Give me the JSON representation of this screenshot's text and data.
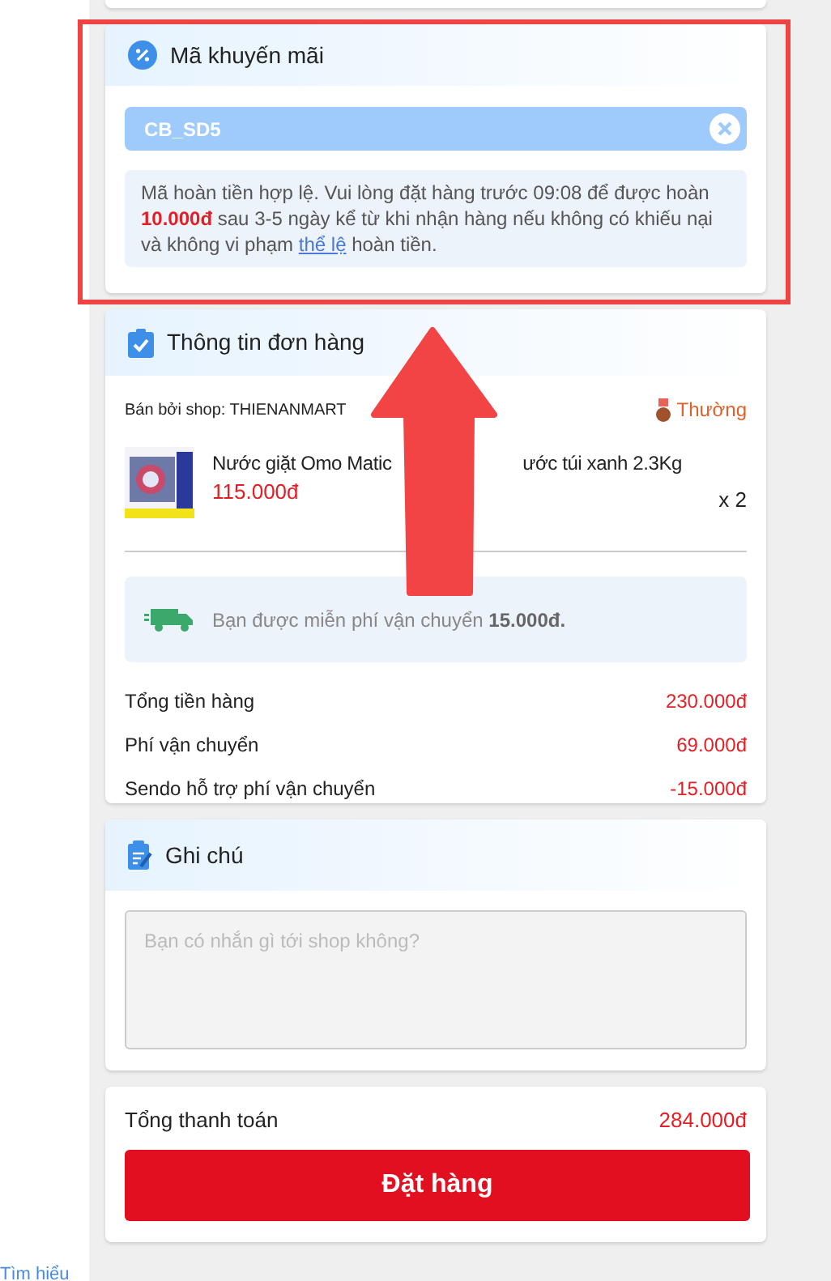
{
  "promo": {
    "title": "Mã khuyến mãi",
    "code": "CB_SD5",
    "notice": "Mã hoàn tiền hợp lệ. Vui lòng đặt hàng trước 09:08 để được hoàn **10.000đ** sau 3-5 ngày kể từ khi nhận hàng nếu không có khiếu nại và không vi phạm",
    "notice_link": "thể lệ",
    "notice_end": "hoàn tiền."
  },
  "order": {
    "title": "Thông tin đơn hàng",
    "seller": "Bán bởi shop: THIENANMART",
    "tier": "Thường",
    "item": {
      "name_parts": [
        "Nước giặt Omo Matic",
        "ước túi xanh 2.3Kg"
      ],
      "price": "115.000đ",
      "quantity": "x 2"
    },
    "shipping_note": "Bạn được miễn phí vận chuyển **15.000đ.**",
    "totals": [
      {
        "label": "Tổng tiền hàng",
        "value": "230.000đ"
      },
      {
        "label": "Phí vận chuyển",
        "value": "69.000đ"
      },
      {
        "label": "Sendo hỗ trợ phí vận chuyển",
        "value": "-15.000đ"
      }
    ]
  },
  "note": {
    "title": "Ghi chú",
    "placeholder": "Bạn có nhắn gì tới shop không?"
  },
  "payment": {
    "label": "Tổng thanh toán",
    "value": "284.000đ",
    "button": "Đặt hàng"
  },
  "side_link": "Tìm hiểu"
}
